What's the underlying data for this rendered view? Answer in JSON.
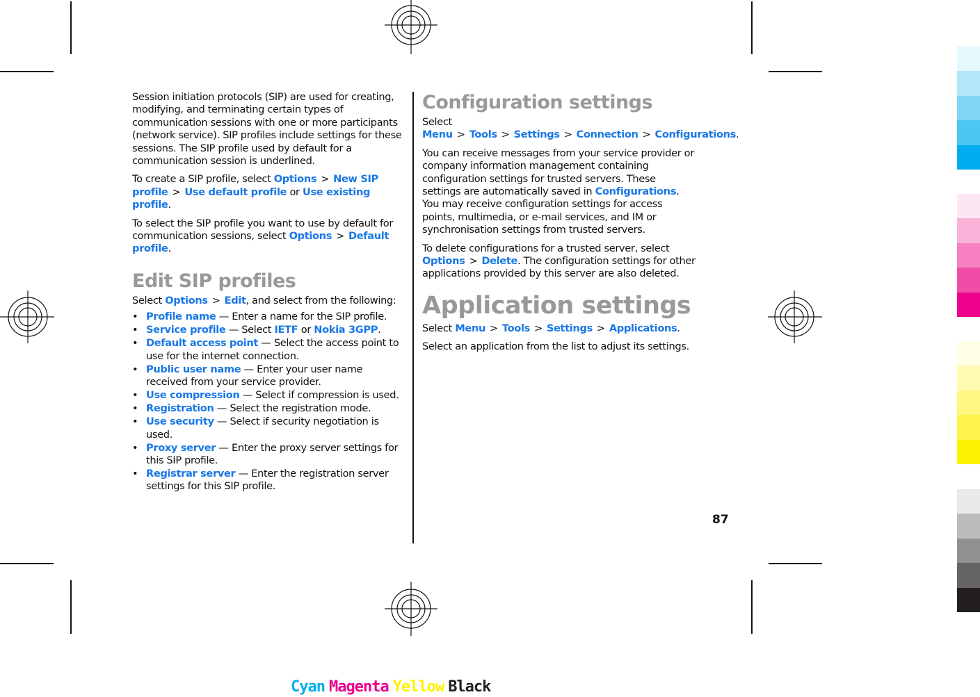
{
  "left_column": {
    "intro": "Session initiation protocols (SIP) are used for creating, modifying, and terminating certain types of communication sessions with one or more participants (network service). SIP profiles include settings for these sessions. The SIP profile used by default for a communication session is underlined.",
    "create": {
      "prefix": "To create a SIP profile, select ",
      "k1": "Options",
      "k2": "New SIP profile",
      "k3": "Use default profile",
      "or": " or ",
      "k4": "Use existing profile",
      "end": "."
    },
    "select_default": {
      "prefix": "To select the SIP profile you want to use by default for communication sessions, select ",
      "k1": "Options",
      "k2": "Default profile",
      "end": "."
    },
    "edit_heading": "Edit SIP profiles",
    "edit_intro": {
      "prefix": "Select ",
      "k1": "Options",
      "k2": "Edit",
      "end": ", and select from the following:"
    },
    "items": [
      {
        "term": "Profile name",
        "desc": " — Enter a name for the SIP profile."
      },
      {
        "term": "Service profile",
        "desc": " — Select ",
        "k1": "IETF",
        "or": " or ",
        "k2": "Nokia 3GPP",
        "end": "."
      },
      {
        "term": "Default access point",
        "desc": " — Select the access point to use for the internet connection."
      },
      {
        "term": "Public user name",
        "desc": " — Enter your user name received from your service provider."
      },
      {
        "term": "Use compression",
        "desc": " — Select if compression is used."
      },
      {
        "term": "Registration",
        "desc": " — Select the registration mode."
      },
      {
        "term": "Use security",
        "desc": " — Select if security negotiation is used."
      },
      {
        "term": "Proxy server",
        "desc": " — Enter the proxy server settings for this SIP profile."
      },
      {
        "term": "Registrar server",
        "desc": " — Enter the registration server settings for this SIP profile."
      }
    ]
  },
  "right_column": {
    "config_heading": "Configuration settings",
    "config_path": {
      "prefix": "Select ",
      "k1": "Menu",
      "k2": "Tools",
      "k3": "Settings",
      "k4": "Connection",
      "k5": "Configurations",
      "end": "."
    },
    "config_body": {
      "text1": "You can receive messages from your service provider or company information management containing configuration settings for trusted servers. These settings are automatically saved in ",
      "k1": "Configurations",
      "text2": ". You may receive configuration settings for access points, multimedia, or e-mail services, and IM or synchronisation settings from trusted servers."
    },
    "delete": {
      "prefix": "To delete configurations for a trusted server, select ",
      "k1": "Options",
      "k2": "Delete",
      "end": ". The configuration settings for other applications provided by this server are also deleted."
    },
    "app_heading": "Application settings",
    "app_path": {
      "prefix": "Select ",
      "k1": "Menu",
      "k2": "Tools",
      "k3": "Settings",
      "k4": "Applications",
      "end": "."
    },
    "app_body": "Select an application from the list to adjust its settings."
  },
  "separator": ">",
  "page_number": "87",
  "color_labels": [
    {
      "text": "Cyan",
      "color": "#00aeef"
    },
    {
      "text": "Magenta",
      "color": "#ec008c"
    },
    {
      "text": "Yellow",
      "color": "#fff200"
    },
    {
      "text": "Black",
      "color": "#231f20"
    }
  ],
  "swatches": {
    "cyan": [
      "#e6f7fd",
      "#b3e6f9",
      "#80d6f6",
      "#4dc6f2",
      "#00aeef"
    ],
    "magenta": [
      "#fde6f3",
      "#f9b3d9",
      "#f680c0",
      "#f24da6",
      "#ec008c"
    ],
    "yellow": [
      "#fffee6",
      "#fffbb3",
      "#fff780",
      "#fff44d",
      "#fff200"
    ],
    "black": [
      "#e9e9e9",
      "#bdbcbc",
      "#919090",
      "#656363",
      "#231f20"
    ]
  },
  "accent_color": "#1a78e6"
}
